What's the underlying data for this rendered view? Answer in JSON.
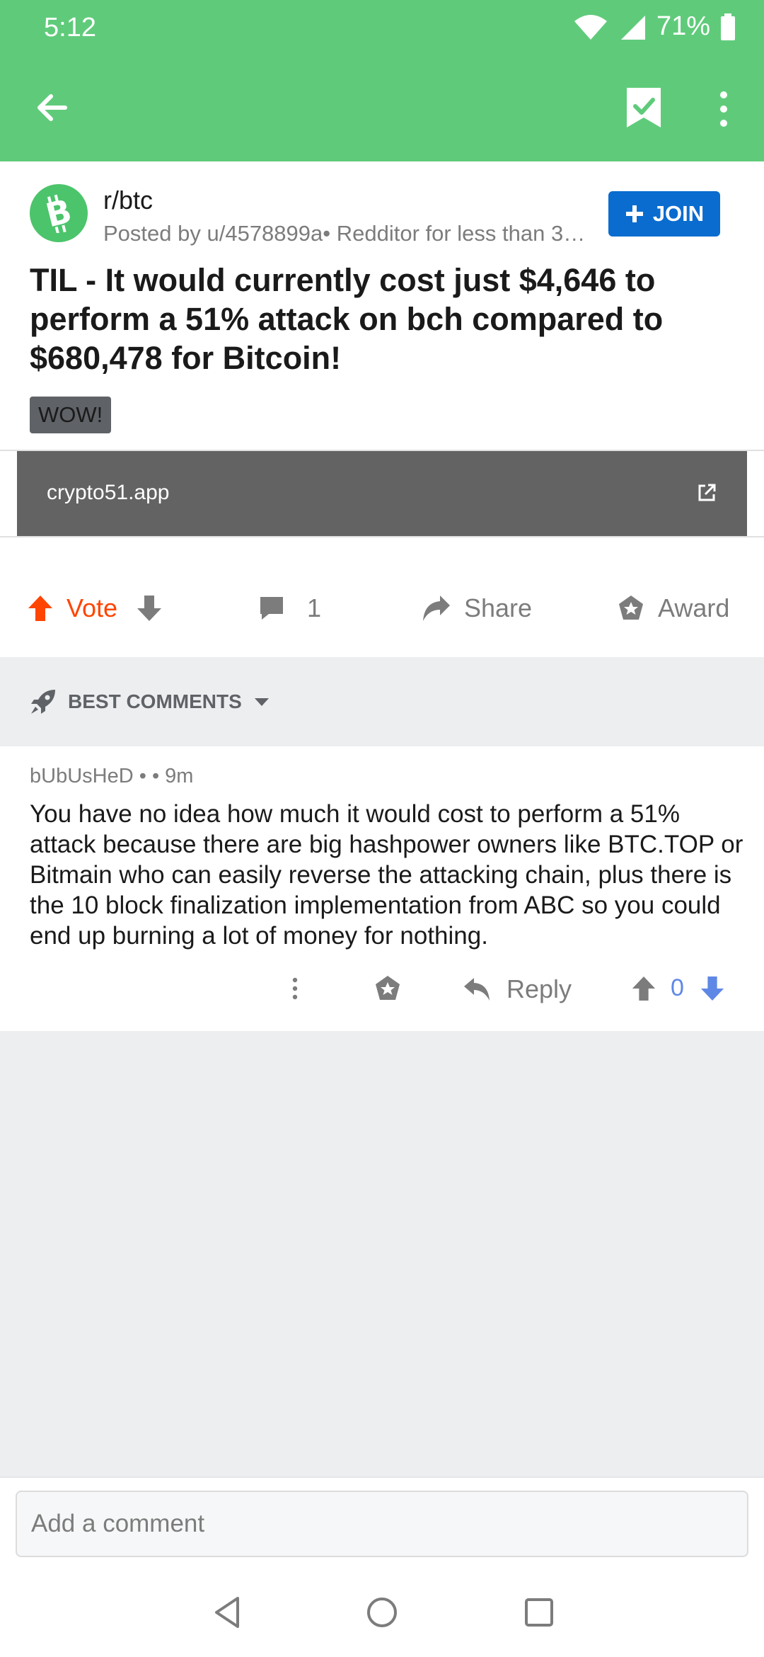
{
  "status": {
    "time": "5:12",
    "battery": "71%"
  },
  "post": {
    "subreddit": "r/btc",
    "posted_by": "Posted by u/4578899a• Redditor for less than 3…",
    "join_label": "JOIN",
    "title": "TIL - It would currently cost just $4,646 to perform a 51% attack on bch compared to $680,478 for Bitcoin!",
    "flair": "WOW!",
    "link_url": "crypto51.app"
  },
  "actions": {
    "vote_label": "Vote",
    "comment_count": "1",
    "share_label": "Share",
    "award_label": "Award"
  },
  "comments": {
    "sort_label": "BEST COMMENTS",
    "items": [
      {
        "author": "bUbUsHeD",
        "meta_sep": " •  • ",
        "age": "9m",
        "body": "You have no idea how much it would cost to perform a 51% attack because there are big hashpower owners like BTC.TOP or Bitmain who can easily reverse the attacking chain, plus there is the 10 block finalization implementation from ABC so you could end up burning a lot of money for nothing.",
        "reply_label": "Reply",
        "score": "0"
      }
    ]
  },
  "composer": {
    "placeholder": "Add a comment"
  },
  "colors": {
    "brand_green": "#5fcb7a",
    "join_blue": "#0a6ccf",
    "upvote_orange": "#ff4500",
    "vote_blue": "#5f87e6"
  }
}
